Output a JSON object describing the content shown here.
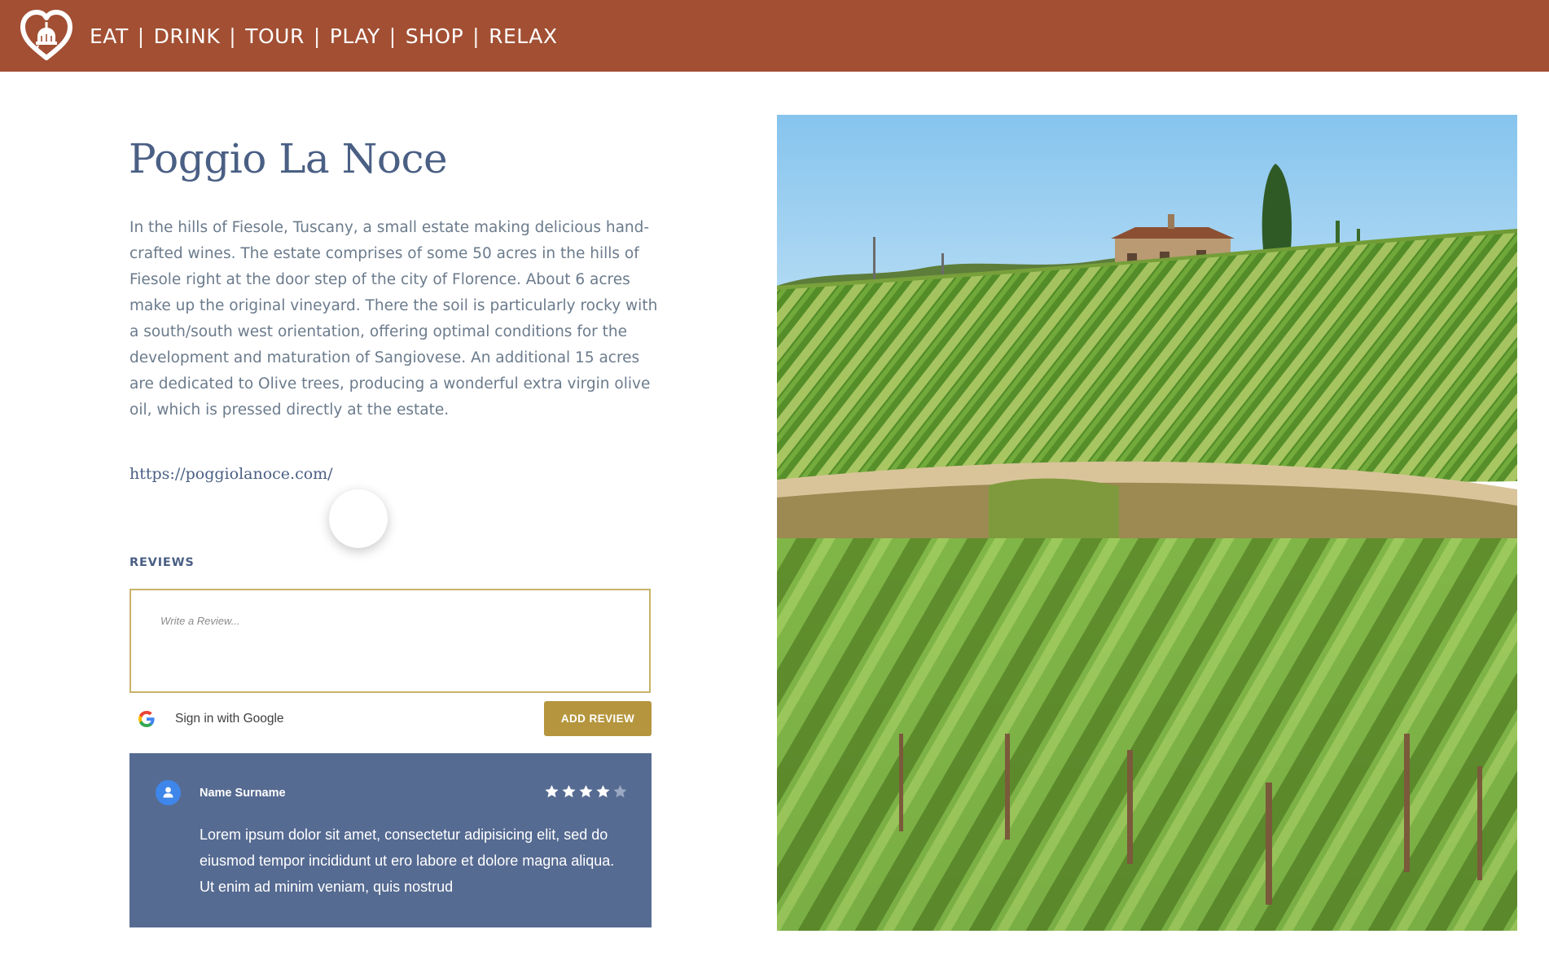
{
  "header": {
    "logo_icon": "heart-duomo-logo-icon",
    "nav": [
      {
        "label": "EAT"
      },
      {
        "label": "DRINK"
      },
      {
        "label": "TOUR"
      },
      {
        "label": "PLAY"
      },
      {
        "label": "SHOP"
      },
      {
        "label": "RELAX"
      }
    ],
    "separator": "|",
    "background": "#a24f33"
  },
  "place": {
    "title": "Poggio La Noce",
    "description": "In the hills of Fiesole, Tuscany, a small estate making delicious hand-crafted wines. The estate comprises of some 50 acres in the hills of Fiesole right at the door step of the city of Florence. About 6 acres make up the original vineyard. There the soil is particularly rocky with a south/south west orientation, offering optimal conditions for the development and maturation of Sangiovese. An additional 15 acres are dedicated to Olive trees, producing a wonderful extra virgin olive oil, which is pressed directly at the estate.",
    "website": "https://poggiolanoce.com/"
  },
  "reviews": {
    "heading": "REVIEWS",
    "input_placeholder": "Write a Review...",
    "google_signin_label": "Sign in with Google",
    "google_icon": "google-g-icon",
    "add_button_label": "ADD REVIEW",
    "accent": "#b5963e",
    "items": [
      {
        "name": "Name Surname",
        "avatar_icon": "user-avatar-icon",
        "rating": 4,
        "rating_max": 5,
        "text": "Lorem ipsum dolor sit amet, consectetur adipisicing elit, sed do eiusmod tempor incididunt ut ero labore et dolore magna aliqua. Ut enim ad minim veniam, quis nostrud",
        "card_color": "#566b92"
      }
    ]
  },
  "image": {
    "subject": "vineyard-hillside-photo"
  },
  "colors": {
    "title": "#4a5f84",
    "body_text": "#6b7b8c"
  }
}
